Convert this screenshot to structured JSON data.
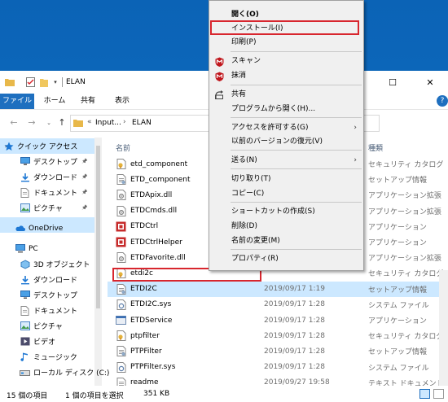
{
  "window": {
    "title": "ELAN",
    "minimize_glyph": "—",
    "maximize_glyph": "☐",
    "close_glyph": "✕"
  },
  "ribbon": {
    "tabs": [
      "ファイル",
      "ホーム",
      "共有",
      "表示"
    ],
    "expand_glyph": "⌄",
    "help_glyph": "?"
  },
  "address": {
    "back_glyph": "←",
    "forward_glyph": "→",
    "recent_glyph": "⌄",
    "up_glyph": "↑",
    "overflow": "«",
    "input_label": "Input...",
    "separator": "›",
    "current": "ELAN"
  },
  "nav": {
    "quick_access": "クイック アクセス",
    "quick_items": [
      "デスクトップ",
      "ダウンロード",
      "ドキュメント",
      "ピクチャ"
    ],
    "onedrive": "OneDrive",
    "pc": "PC",
    "pc_items": [
      "3D オブジェクト",
      "ダウンロード",
      "デスクトップ",
      "ドキュメント",
      "ピクチャ",
      "ビデオ",
      "ミュージック",
      "ローカル ディスク (C:)"
    ]
  },
  "columns": {
    "name": "名前",
    "type": "種類"
  },
  "files": [
    {
      "name": "etd_component",
      "date": "",
      "type": "セキュリティ カタログ",
      "icon": "catalog-icon"
    },
    {
      "name": "ETD_component",
      "date": "",
      "type": "セットアップ情報",
      "icon": "setup-info-icon"
    },
    {
      "name": "ETDApix.dll",
      "date": "",
      "type": "アプリケーション拡張",
      "icon": "dll-icon"
    },
    {
      "name": "ETDCmds.dll",
      "date": "",
      "type": "アプリケーション拡張",
      "icon": "dll-icon"
    },
    {
      "name": "ETDCtrl",
      "date": "",
      "type": "アプリケーション",
      "icon": "elan-app-icon"
    },
    {
      "name": "ETDCtrlHelper",
      "date": "",
      "type": "アプリケーション",
      "icon": "elan-app-icon"
    },
    {
      "name": "ETDFavorite.dll",
      "date": "",
      "type": "アプリケーション拡張",
      "icon": "dll-icon"
    },
    {
      "name": "etdi2c",
      "date": "",
      "type": "セキュリティ カタログ",
      "icon": "catalog-icon"
    },
    {
      "name": "ETDI2C",
      "date": "2019/09/17 1:19",
      "type": "セットアップ情報",
      "icon": "setup-info-icon"
    },
    {
      "name": "ETDI2C.sys",
      "date": "2019/09/17 1:28",
      "type": "システム ファイル",
      "icon": "sys-file-icon"
    },
    {
      "name": "ETDService",
      "date": "2019/09/17 1:28",
      "type": "アプリケーション",
      "icon": "service-icon"
    },
    {
      "name": "ptpfilter",
      "date": "2019/09/17 1:28",
      "type": "セキュリティ カタログ",
      "icon": "catalog-icon"
    },
    {
      "name": "PTPFilter",
      "date": "2019/09/17 1:28",
      "type": "セットアップ情報",
      "icon": "setup-info-icon"
    },
    {
      "name": "PTPFilter.sys",
      "date": "2019/09/17 1:28",
      "type": "システム ファイル",
      "icon": "sys-file-icon"
    },
    {
      "name": "readme",
      "date": "2019/09/27 19:58",
      "type": "テキスト ドキュメント",
      "icon": "text-doc-icon"
    }
  ],
  "status": {
    "count": "15 個の項目",
    "selected": "1 個の項目を選択",
    "size": "351 KB"
  },
  "context_menu": {
    "items": [
      "開く(O)",
      "インストール(I)",
      "印刷(P)",
      "スキャン",
      "抹消",
      "共有",
      "プログラムから開く(H)...",
      "アクセスを許可する(G)",
      "以前のバージョンの復元(V)",
      "送る(N)",
      "切り取り(T)",
      "コピー(C)",
      "ショートカットの作成(S)",
      "削除(D)",
      "名前の変更(M)",
      "プロパティ(R)"
    ],
    "submenu_glyph": "›"
  },
  "colors": {
    "accent": "#1e6fbf",
    "selection": "#cce8ff",
    "highlight": "#d8262e",
    "desktop": "#0b63b6"
  }
}
